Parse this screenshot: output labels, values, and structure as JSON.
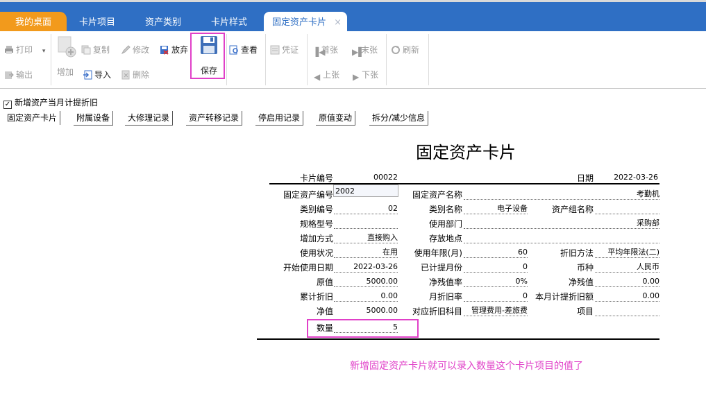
{
  "tabs": [
    {
      "label": "我的桌面"
    },
    {
      "label": "卡片项目"
    },
    {
      "label": "资产类别"
    },
    {
      "label": "卡片样式"
    },
    {
      "label": "固定资产卡片",
      "close": "×"
    }
  ],
  "toolbar": {
    "print": "打印",
    "print_dropdown": "▾",
    "export": "输出",
    "add": "增加",
    "copy": "复制",
    "modify": "修改",
    "abandon": "放弃",
    "import": "导入",
    "delete": "删除",
    "save": "保存",
    "view": "查看",
    "voucher": "凭证",
    "first": "首张",
    "last": "末张",
    "prev": "上张",
    "next": "下张",
    "refresh": "刷新"
  },
  "options": {
    "checkbox_label": "新增资产当月计提折旧",
    "checked": "✓"
  },
  "subtabs": [
    "固定资产卡片",
    "附属设备",
    "大修理记录",
    "资产转移记录",
    "停启用记录",
    "原值变动",
    "拆分/减少信息"
  ],
  "card": {
    "title": "固定资产卡片",
    "card_no_label": "卡片编号",
    "card_no": "00022",
    "date_label": "日期",
    "date": "2022-03-26",
    "asset_no_label": "固定资产编号",
    "asset_no": "2002",
    "asset_name_label": "固定资产名称",
    "asset_name": "考勤机",
    "category_no_label": "类别编号",
    "category_no": "02",
    "category_name_label": "类别名称",
    "category_name": "电子设备",
    "group_label": "资产组名称",
    "group": "",
    "spec_label": "规格型号",
    "spec": "",
    "dept_label": "使用部门",
    "dept": "采购部",
    "add_method_label": "增加方式",
    "add_method": "直接购入",
    "location_label": "存放地点",
    "location": "",
    "status_label": "使用状况",
    "status": "在用",
    "life_label": "使用年限(月)",
    "life": "60",
    "method_label": "折旧方法",
    "method": "平均年限法(二)",
    "start_label": "开始使用日期",
    "start": "2022-03-26",
    "accrued_label": "已计提月份",
    "accrued": "0",
    "currency_label": "币种",
    "currency": "人民币",
    "orig_label": "原值",
    "orig": "5000.00",
    "salvage_rate_label": "净残值率",
    "salvage_rate": "0%",
    "salvage_label": "净残值",
    "salvage": "0.00",
    "accum_label": "累计折旧",
    "accum": "0.00",
    "monthly_rate_label": "月折旧率",
    "monthly_rate": "0",
    "monthly_amt_label": "本月计提折旧额",
    "monthly_amt": "0.00",
    "net_label": "净值",
    "net": "5000.00",
    "account_label": "对应折旧科目",
    "account": "管理费用-差旅费",
    "project_label": "项目",
    "project": "",
    "qty_label": "数量",
    "qty": "5"
  },
  "annotation": "新增固定资产卡片就可以录入数量这个卡片项目的值了",
  "colors": {
    "tabbar": "#2f6fc4",
    "home_tab": "#f29a1c",
    "highlight": "#e040c8"
  }
}
